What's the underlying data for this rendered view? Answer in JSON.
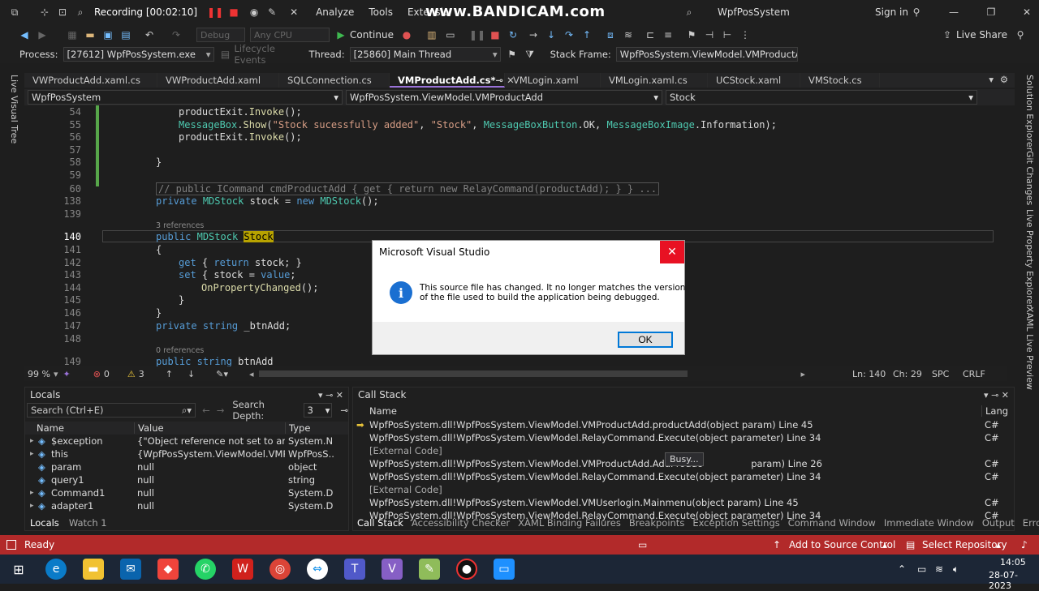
{
  "title_bar": {
    "recording": "Recording [00:02:10]",
    "menus": [
      "Analyze",
      "Tools",
      "Extensio"
    ],
    "watermark": "www.BANDICAM.com",
    "app_name": "WpfPosSystem",
    "sign_in": "Sign in"
  },
  "toolbar": {
    "config": "Debug",
    "platform": "Any CPU",
    "continue": "Continue",
    "live_share": "Live Share"
  },
  "debug_bar": {
    "process_label": "Process:",
    "process_value": "[27612] WpfPosSystem.exe",
    "lifecycle": "Lifecycle Events",
    "thread_label": "Thread:",
    "thread_value": "[25860] Main Thread",
    "stack_frame_label": "Stack Frame:",
    "stack_frame_value": "WpfPosSystem.ViewModel.VMProductAd"
  },
  "side_left": "Live Visual Tree",
  "side_right": [
    "Solution Explorer",
    "Git Changes",
    "Live Property Explorer",
    "XAML Live Preview"
  ],
  "tabs": [
    "VWProductAdd.xaml.cs",
    "VWProductAdd.xaml",
    "SQLConnection.cs",
    "VMProductAdd.cs*",
    "VMLogin.xaml",
    "VMLogin.xaml.cs",
    "UCStock.xaml",
    "VMStock.cs"
  ],
  "nav": {
    "project": "WpfPosSystem",
    "class": "WpfPosSystem.ViewModel.VMProductAdd",
    "member": "Stock"
  },
  "code": {
    "l54": "54",
    "l55": "55",
    "l56": "56",
    "l57": "57",
    "l58": "58",
    "l59": "59",
    "l60": "60",
    "l138": "138",
    "l139": "139",
    "l140": "140",
    "l141": "141",
    "l142": "142",
    "l143": "143",
    "l144": "144",
    "l145": "145",
    "l146": "146",
    "l147": "147",
    "l148": "148",
    "l149": "149",
    "ref3": "3 references",
    "ref0": "0 references"
  },
  "editor_status": {
    "zoom": "99 %",
    "errors": "0",
    "warnings": "3",
    "ln": "Ln: 140",
    "ch": "Ch: 29",
    "spc": "SPC",
    "crlf": "CRLF"
  },
  "locals": {
    "title": "Locals",
    "search_placeholder": "Search (Ctrl+E)",
    "depth_label": "Search Depth:",
    "depth_value": "3",
    "columns": [
      "Name",
      "Value",
      "Type"
    ],
    "rows": [
      {
        "name": "$exception",
        "value": "{\"Object reference not set to an ins...",
        "type": "System.N..."
      },
      {
        "name": "this",
        "value": "{WpfPosSystem.ViewModel.VMPro...",
        "type": "WpfPosS..."
      },
      {
        "name": "param",
        "value": "null",
        "type": "object"
      },
      {
        "name": "query1",
        "value": "null",
        "type": "string"
      },
      {
        "name": "Command1",
        "value": "null",
        "type": "System.D..."
      },
      {
        "name": "adapter1",
        "value": "null",
        "type": "System.D..."
      }
    ],
    "tabs": [
      "Locals",
      "Watch 1"
    ]
  },
  "callstack": {
    "title": "Call Stack",
    "columns": [
      "Name",
      "Lang"
    ],
    "rows": [
      {
        "name": "WpfPosSystem.dll!WpfPosSystem.ViewModel.VMProductAdd.productAdd(object param) Line 45",
        "lang": "C#"
      },
      {
        "name": "WpfPosSystem.dll!WpfPosSystem.ViewModel.RelayCommand.Execute(object parameter) Line 34",
        "lang": "C#"
      },
      {
        "name": "[External Code]",
        "lang": ""
      },
      {
        "name": "WpfPosSystem.dll!WpfPosSystem.ViewModel.VMProductAdd.AddProduc",
        "lang": "C#"
      },
      {
        "name": "WpfPosSystem.dll!WpfPosSystem.ViewModel.RelayCommand.Execute(object parameter) Line 34",
        "lang": "C#"
      },
      {
        "name": "[External Code]",
        "lang": ""
      },
      {
        "name": "WpfPosSystem.dll!WpfPosSystem.ViewModel.VMUserlogin.Mainmenu(object param) Line 45",
        "lang": "C#"
      },
      {
        "name": "WpfPosSystem.dll!WpfPosSystem.ViewModel.RelayCommand.Execute(object parameter) Line 34",
        "lang": "C#"
      }
    ],
    "busy_tooltip": "Busy...",
    "row4_tail": "param) Line 26",
    "tabs": [
      "Call Stack",
      "Accessibility Checker",
      "XAML Binding Failures",
      "Breakpoints",
      "Exception Settings",
      "Command Window",
      "Immediate Window",
      "Output",
      "Error List"
    ]
  },
  "dialog": {
    "title": "Microsoft Visual Studio",
    "message1": "This source file has changed. It no longer matches the version",
    "message2": "of the file used to build the application being debugged.",
    "ok": "OK"
  },
  "status": {
    "ready": "Ready",
    "source_control": "Add to Source Control",
    "repository": "Select Repository"
  },
  "taskbar": {
    "time": "14:05",
    "date": "28-07-2023"
  },
  "colors": {
    "accent_purple": "#9a72d9",
    "status_red": "#b22a2a",
    "taskbar": "#1c2636",
    "keyword": "#569cd6",
    "type": "#4ec9b0",
    "string": "#d69d85"
  }
}
